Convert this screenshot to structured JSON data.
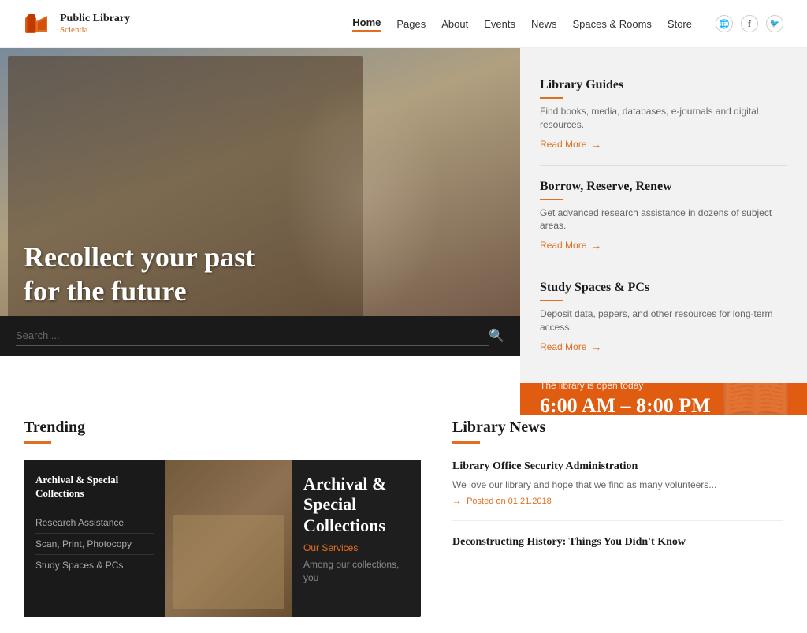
{
  "header": {
    "logo_title": "Public Library",
    "logo_subtitle": "Scientia",
    "nav_items": [
      {
        "label": "Home",
        "active": true
      },
      {
        "label": "Pages",
        "active": false
      },
      {
        "label": "About",
        "active": false
      },
      {
        "label": "Events",
        "active": false
      },
      {
        "label": "News",
        "active": false
      },
      {
        "label": "Spaces & Rooms",
        "active": false
      },
      {
        "label": "Store",
        "active": false
      }
    ],
    "social_icons": [
      "🌐",
      "f",
      "🐦"
    ]
  },
  "hero": {
    "heading_line1": "Recollect your past",
    "heading_line2": "for the future",
    "search_placeholder": "Search ..."
  },
  "info_panels": [
    {
      "title": "Library Guides",
      "text": "Find books, media, databases, e-journals and digital resources.",
      "read_more": "Read More"
    },
    {
      "title": "Borrow, Reserve, Renew",
      "text": "Get advanced research assistance in dozens of subject areas.",
      "read_more": "Read More"
    },
    {
      "title": "Study Spaces & PCs",
      "text": "Deposit data, papers, and other resources for long-term access.",
      "read_more": "Read More"
    }
  ],
  "hours": {
    "today_label": "The library is open today",
    "time": "6:00 AM – 8:00 PM"
  },
  "trending": {
    "section_title": "Trending",
    "card": {
      "sidebar_title": "Archival & Special Collections",
      "sidebar_items": [
        "Research Assistance",
        "Scan, Print, Photocopy",
        "Study Spaces & PCs"
      ],
      "content_title": "Archival & Special Collections",
      "content_subtitle": "Our Services",
      "content_text": "Among our collections, you"
    }
  },
  "library_news": {
    "section_title": "Library News",
    "items": [
      {
        "title": "Library Office Security Administration",
        "text": "We love our library and hope that we find as many volunteers...",
        "date": "Posted on 01.21.2018"
      },
      {
        "title": "Deconstructing History: Things You Didn't Know",
        "text": "",
        "date": ""
      }
    ]
  }
}
